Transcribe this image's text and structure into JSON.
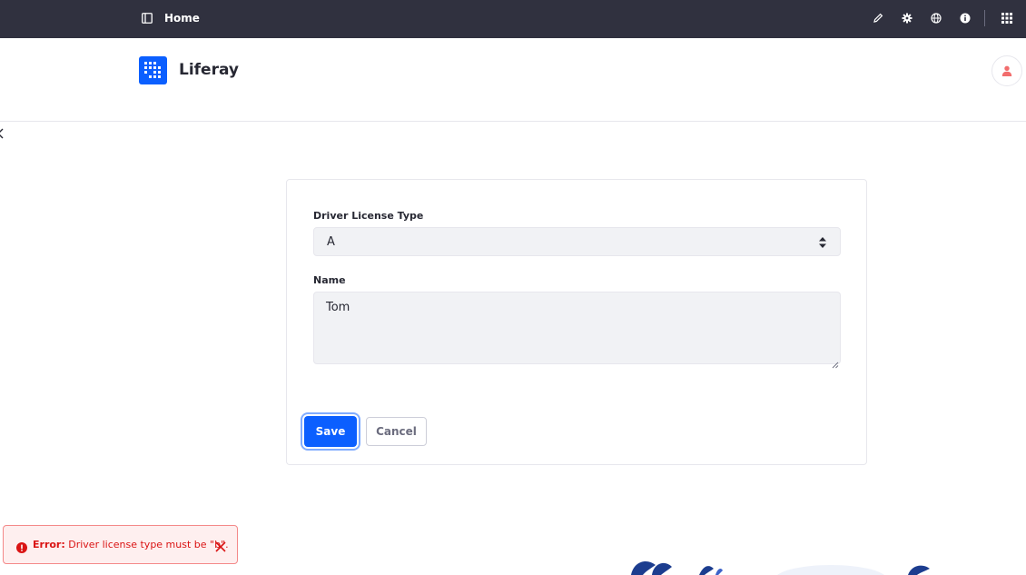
{
  "topbar": {
    "title": "Home",
    "icons": [
      "panel-toggle-icon",
      "pencil-icon",
      "gear-icon",
      "globe-icon",
      "info-icon",
      "apps-grid-icon"
    ]
  },
  "header": {
    "brand": "Liferay"
  },
  "form": {
    "driver_license_type": {
      "label": "Driver License Type",
      "value": "A"
    },
    "name": {
      "label": "Name",
      "value": "Tom"
    },
    "save_label": "Save",
    "cancel_label": "Cancel"
  },
  "toast": {
    "prefix": "Error:",
    "message": "Driver license type must be \"b\"."
  },
  "colors": {
    "topbar": "#30313f",
    "primary": "#0b5fff",
    "error": "#da1414",
    "error_bg": "#feefef",
    "input_bg": "#f1f2f5"
  }
}
